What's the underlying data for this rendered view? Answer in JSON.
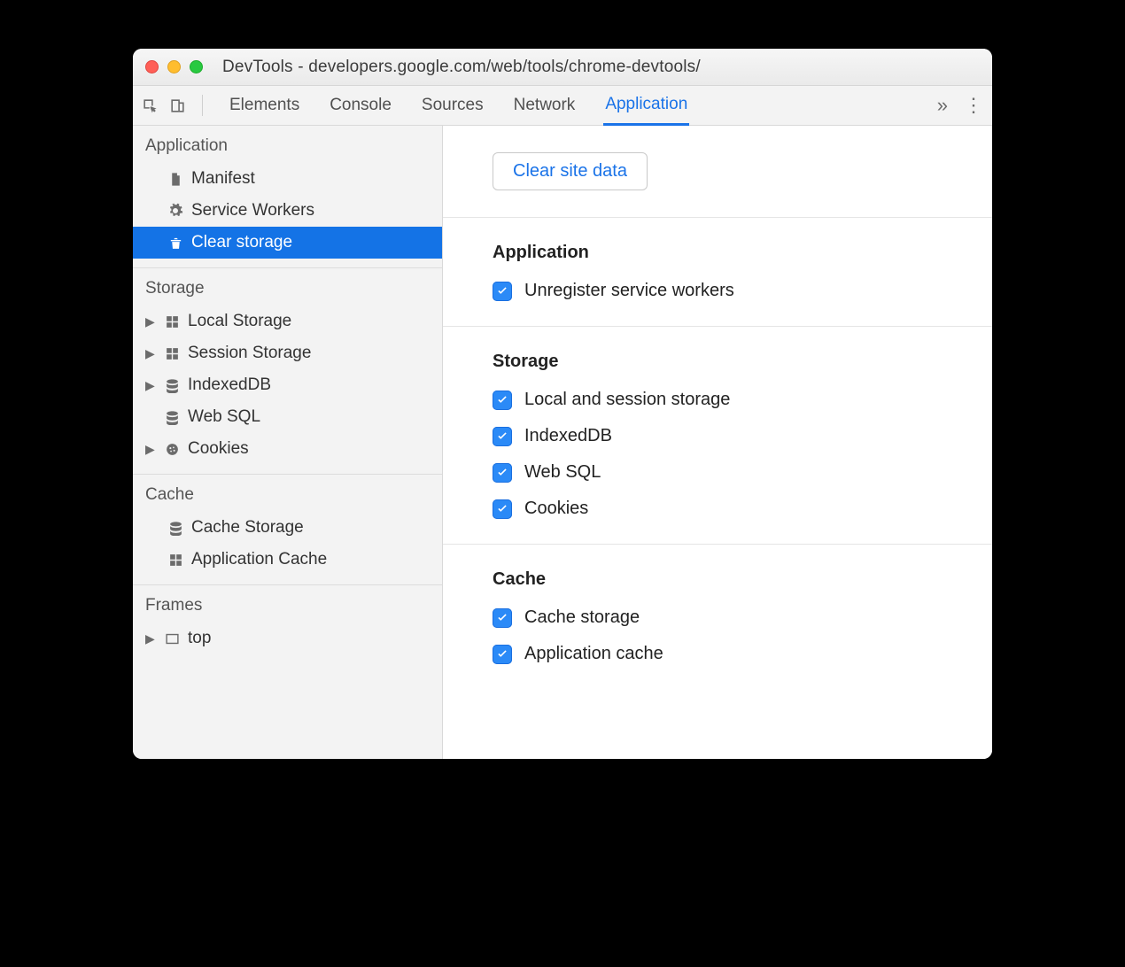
{
  "window": {
    "title": "DevTools - developers.google.com/web/tools/chrome-devtools/"
  },
  "tabs": {
    "items": [
      "Elements",
      "Console",
      "Sources",
      "Network",
      "Application"
    ],
    "active": "Application"
  },
  "sidebar": {
    "sections": [
      {
        "title": "Application",
        "items": [
          {
            "icon": "file-icon",
            "label": "Manifest",
            "caret": false
          },
          {
            "icon": "gear-icon",
            "label": "Service Workers",
            "caret": false
          },
          {
            "icon": "trash-icon",
            "label": "Clear storage",
            "caret": false,
            "selected": true
          }
        ]
      },
      {
        "title": "Storage",
        "items": [
          {
            "icon": "grid-icon",
            "label": "Local Storage",
            "caret": true
          },
          {
            "icon": "grid-icon",
            "label": "Session Storage",
            "caret": true
          },
          {
            "icon": "database-icon",
            "label": "IndexedDB",
            "caret": true
          },
          {
            "icon": "database-icon",
            "label": "Web SQL",
            "caret": false
          },
          {
            "icon": "cookie-icon",
            "label": "Cookies",
            "caret": true
          }
        ]
      },
      {
        "title": "Cache",
        "items": [
          {
            "icon": "database-icon",
            "label": "Cache Storage",
            "caret": false
          },
          {
            "icon": "grid-icon",
            "label": "Application Cache",
            "caret": false
          }
        ]
      },
      {
        "title": "Frames",
        "items": [
          {
            "icon": "frame-icon",
            "label": "top",
            "caret": true
          }
        ]
      }
    ]
  },
  "main": {
    "clear_button": "Clear site data",
    "groups": [
      {
        "title": "Application",
        "checks": [
          {
            "label": "Unregister service workers",
            "checked": true
          }
        ]
      },
      {
        "title": "Storage",
        "checks": [
          {
            "label": "Local and session storage",
            "checked": true
          },
          {
            "label": "IndexedDB",
            "checked": true
          },
          {
            "label": "Web SQL",
            "checked": true
          },
          {
            "label": "Cookies",
            "checked": true
          }
        ]
      },
      {
        "title": "Cache",
        "checks": [
          {
            "label": "Cache storage",
            "checked": true
          },
          {
            "label": "Application cache",
            "checked": true
          }
        ]
      }
    ]
  }
}
